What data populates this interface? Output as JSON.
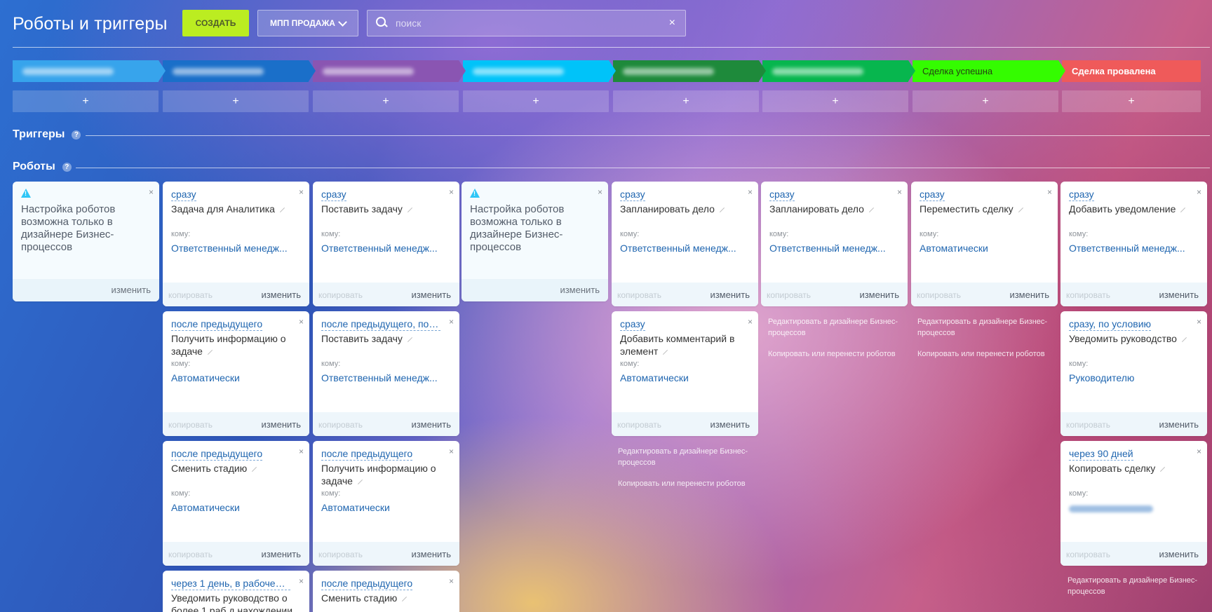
{
  "header": {
    "title": "Роботы и триггеры",
    "create_label": "СОЗДАТЬ",
    "pipeline_label": "МПП ПРОДАЖА",
    "search_placeholder": "поиск"
  },
  "stages": [
    {
      "label": "",
      "color": "#37a4ec"
    },
    {
      "label": "",
      "color": "#1a6fc9"
    },
    {
      "label": "",
      "color": "#8a55b2"
    },
    {
      "label": "",
      "color": "#00c3f9"
    },
    {
      "label": "",
      "color": "#1e8a3b"
    },
    {
      "label": "",
      "color": "#07b64e"
    },
    {
      "label": "Сделка успешна",
      "color": "#34fc00"
    },
    {
      "label": "Сделка провалена",
      "color": "#ef5a5a"
    }
  ],
  "plus_symbol": "+",
  "sections": {
    "triggers": "Триггеры",
    "robots": "Роботы",
    "help_symbol": "?"
  },
  "common": {
    "to_label": "кому:",
    "copy_label": "копировать",
    "edit_label": "изменить",
    "close_symbol": "×"
  },
  "info_card": {
    "text": "Настройка роботов возможна только в дизайнере Бизнес-процессов",
    "edit_label": "изменить"
  },
  "robots": {
    "col2": [
      {
        "delay": "сразу",
        "name": "Задача для Аналитика",
        "to": "Ответственный менедж..."
      },
      {
        "delay": "после предыдущего",
        "name": "Получить информацию о задаче",
        "to": "Автоматически"
      },
      {
        "delay": "после предыдущего",
        "name": "Сменить стадию",
        "to": "Автоматически"
      },
      {
        "delay": "через 1 день, в рабочее в...",
        "name": "Уведомить руководство о более 1 раб.д нахождении",
        "to": ""
      }
    ],
    "col3": [
      {
        "delay": "сразу",
        "name": "Поставить задачу",
        "to": "Ответственный менедж..."
      },
      {
        "delay": "после предыдущего, по у...",
        "name": "Поставить задачу",
        "to": "Ответственный менедж..."
      },
      {
        "delay": "после предыдущего",
        "name": "Получить информацию о задаче",
        "to": "Автоматически"
      },
      {
        "delay": "после предыдущего",
        "name": "Сменить стадию",
        "to": ""
      }
    ],
    "col5": [
      {
        "delay": "сразу",
        "name": "Запланировать дело",
        "to": "Ответственный менедж..."
      },
      {
        "delay": "сразу",
        "name": "Добавить комментарий в элемент",
        "to": "Автоматически"
      }
    ],
    "col6": [
      {
        "delay": "сразу",
        "name": "Запланировать дело",
        "to": "Ответственный менедж..."
      }
    ],
    "col7": [
      {
        "delay": "сразу",
        "name": "Переместить сделку",
        "to": "Автоматически"
      }
    ],
    "col8": [
      {
        "delay": "сразу",
        "name": "Добавить уведомление",
        "to": "Ответственный менедж..."
      },
      {
        "delay": "сразу, по условию",
        "name": "Уведомить руководство",
        "to": "Руководителю"
      },
      {
        "delay": "через 90 дней",
        "name": "Копировать сделку",
        "to": ""
      }
    ]
  },
  "links": {
    "designer": "Редактировать в дизайнере Бизнес-процессов",
    "copy_move": "Копировать или перенести роботов"
  }
}
